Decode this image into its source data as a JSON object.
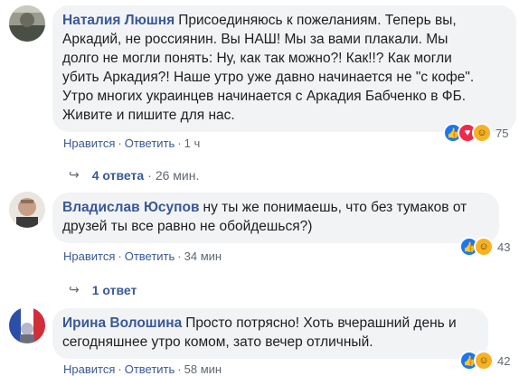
{
  "comments": [
    {
      "author": "Наталия Люшня",
      "text_lines": [
        "Присоединяюсь к пожеланиям. Теперь вы,",
        "Аркадий, не россиянин. Вы НАШ! Мы за вами плакали. Мы",
        "долго не могли понять: Ну, как так можно?! Как!!? Как могли",
        "убить Аркадия?! Наше утро уже давно начинается не \"с кофе\".",
        "Утро многих украинцев начинается с Аркадия Бабченко в ФБ.",
        "Живите и пишите для нас."
      ],
      "like_label": "Нравится",
      "reply_label": "Ответить",
      "time": "1 ч",
      "reactions": [
        "like-icon",
        "love-icon",
        "haha-icon"
      ],
      "reaction_count": "75",
      "replies_label": "4 ответа",
      "replies_time": "26 мин."
    },
    {
      "author": "Владислав Юсупов",
      "text_lines": [
        "ну ты же понимаешь, что без тумаков от",
        "друзей ты все равно не обойдешься?)"
      ],
      "like_label": "Нравится",
      "reply_label": "Ответить",
      "time": "34 мин",
      "reactions": [
        "like-icon",
        "haha-icon"
      ],
      "reaction_count": "43",
      "replies_label": "1 ответ"
    },
    {
      "author": "Ирина Волошина",
      "text_lines": [
        "Просто потрясно! Хоть вчерашний день и",
        "сегодняшнее утро комом, зато вечер отличный."
      ],
      "like_label": "Нравится",
      "reply_label": "Ответить",
      "time": "58 мин",
      "reactions": [
        "like-icon",
        "haha-icon"
      ],
      "reaction_count": "42"
    }
  ],
  "colors": {
    "name": "#385898",
    "bubble": "#f2f3f5",
    "meta": "#606770"
  }
}
